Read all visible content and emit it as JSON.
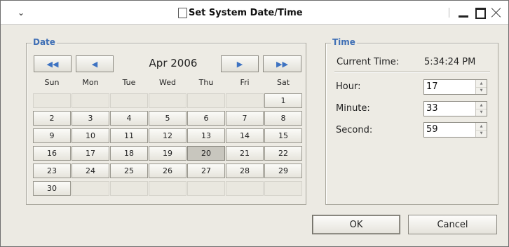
{
  "window": {
    "title": "Set System Date/Time",
    "menu_glyph": "⌄"
  },
  "date_group": {
    "title": "Date",
    "month_label": "Apr 2006",
    "nav": {
      "prev_year": "◀◀",
      "prev_month": "◀",
      "next_month": "▶",
      "next_year": "▶▶"
    },
    "weekdays": [
      "Sun",
      "Mon",
      "Tue",
      "Wed",
      "Thu",
      "Fri",
      "Sat"
    ],
    "weeks": [
      [
        "",
        "",
        "",
        "",
        "",
        "",
        "1"
      ],
      [
        "2",
        "3",
        "4",
        "5",
        "6",
        "7",
        "8"
      ],
      [
        "9",
        "10",
        "11",
        "12",
        "13",
        "14",
        "15"
      ],
      [
        "16",
        "17",
        "18",
        "19",
        "20",
        "21",
        "22"
      ],
      [
        "23",
        "24",
        "25",
        "26",
        "27",
        "28",
        "29"
      ],
      [
        "30",
        "",
        "",
        "",
        "",
        "",
        ""
      ]
    ],
    "selected_day": "20"
  },
  "time_group": {
    "title": "Time",
    "current_time_label": "Current Time:",
    "current_time_value": "5:34:24 PM",
    "hour_label": "Hour:",
    "hour_value": "17",
    "minute_label": "Minute:",
    "minute_value": "33",
    "second_label": "Second:",
    "second_value": "59"
  },
  "actions": {
    "ok_label": "OK",
    "cancel_label": "Cancel"
  }
}
